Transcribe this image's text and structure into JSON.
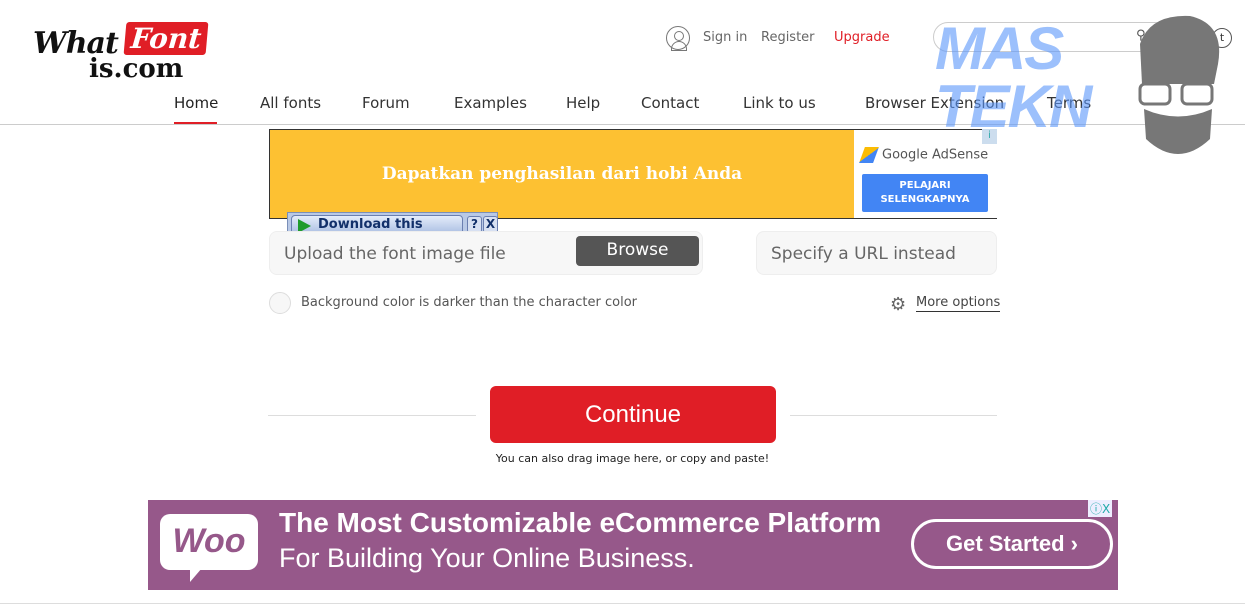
{
  "logo": {
    "text": "WhatFontis.com",
    "part1": "What",
    "part2": "Font",
    "part3": "is.com"
  },
  "header": {
    "sign_in": "Sign in",
    "register": "Register",
    "upgrade": "Upgrade",
    "search_placeholder": ""
  },
  "nav": [
    {
      "label": "Home",
      "active": true
    },
    {
      "label": "All fonts"
    },
    {
      "label": "Forum"
    },
    {
      "label": "Examples"
    },
    {
      "label": "Help"
    },
    {
      "label": "Contact"
    },
    {
      "label": "Link to us"
    },
    {
      "label": "Browser Extension"
    },
    {
      "label": "Terms"
    }
  ],
  "ad_top": {
    "headline": "Dapatkan penghasilan dari hobi Anda",
    "brand": "Google AdSense",
    "button_line1": "PELAJARI",
    "button_line2": "SELENGKAPNYA",
    "color": "#fdc132"
  },
  "download_overlay": {
    "label": "Download this video",
    "help": "?",
    "close": "X"
  },
  "upload": {
    "placeholder": "Upload the font image file",
    "browse": "Browse",
    "url_placeholder": "Specify a URL instead"
  },
  "options": {
    "checkbox_label": "Background color is darker than the character color",
    "checked": false,
    "more_options": "More options"
  },
  "continue": {
    "label": "Continue",
    "hint": "You can also drag image here, or copy and paste!",
    "color": "#e01e26"
  },
  "ad_bottom": {
    "logo": "Woo",
    "headline": "The Most Customizable eCommerce Platform",
    "subline": "For Building Your Online Business.",
    "button": "Get Started ›",
    "color": "#96588a"
  },
  "watermark": {
    "text": "MAS TEKN"
  }
}
